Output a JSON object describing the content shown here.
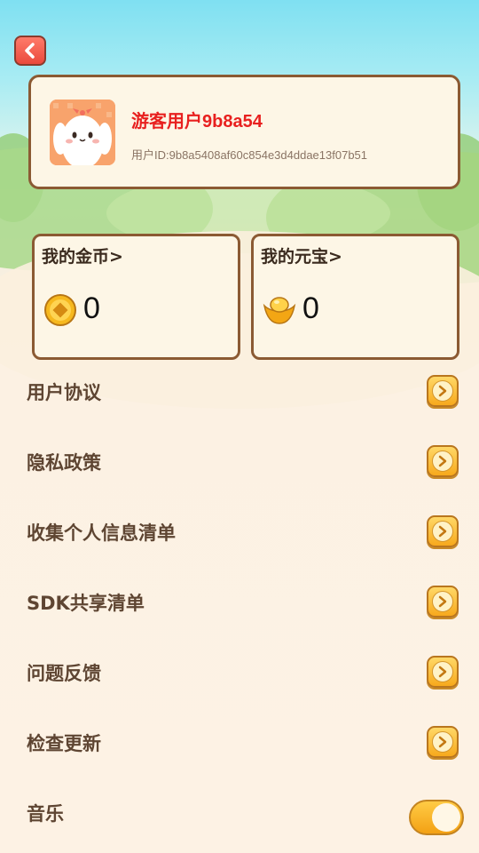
{
  "header": {
    "back_icon": "chevron-left-icon"
  },
  "profile": {
    "username": "游客用户9b8a54",
    "user_id": "用户ID:9b8a5408af60c854e3d4ddae13f07b51",
    "avatar_icon": "bunny-avatar"
  },
  "wallet": {
    "coins": {
      "title": "我的金币>",
      "value": "0",
      "icon": "gold-coin-icon"
    },
    "ingots": {
      "title": "我的元宝>",
      "value": "0",
      "icon": "gold-ingot-icon"
    }
  },
  "menu": [
    {
      "label": "用户协议",
      "control": "arrow"
    },
    {
      "label": "隐私政策",
      "control": "arrow"
    },
    {
      "label": "收集个人信息清单",
      "control": "arrow"
    },
    {
      "label": "SDK共享清单",
      "control": "arrow"
    },
    {
      "label": "问题反馈",
      "control": "arrow"
    },
    {
      "label": "检查更新",
      "control": "arrow"
    },
    {
      "label": "音乐",
      "control": "toggle",
      "toggle_on": true
    }
  ],
  "colors": {
    "username": "#e8201f",
    "card_border": "#8b5a33",
    "card_bg": "#fdf6e6",
    "accent": "#f7a91c"
  }
}
